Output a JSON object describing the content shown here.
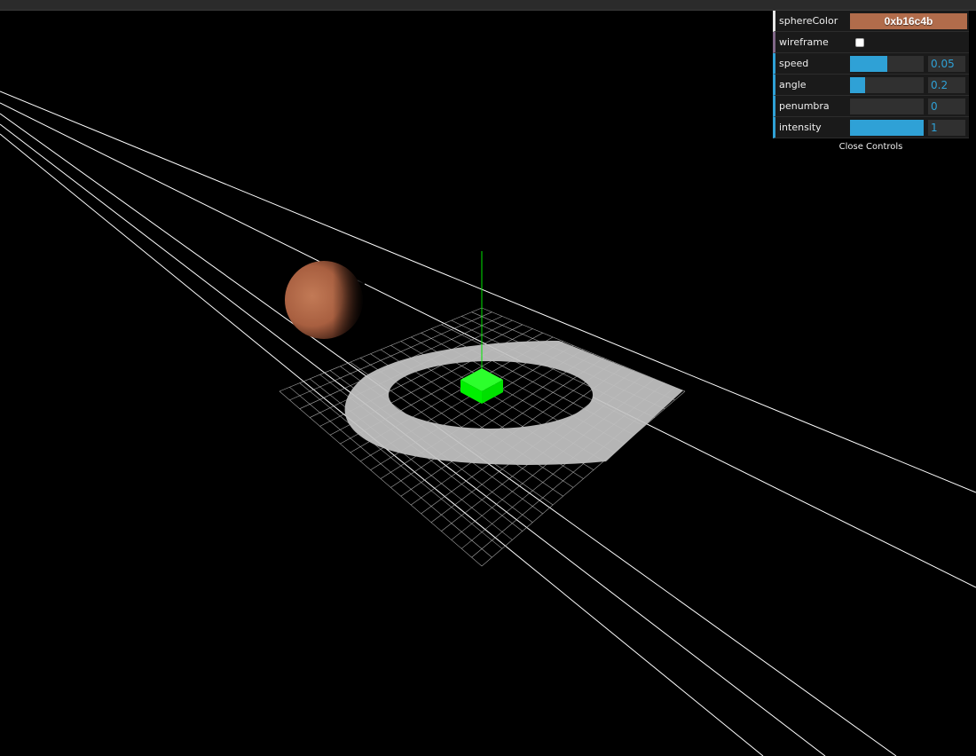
{
  "controls": {
    "sphereColor": {
      "label": "sphereColor",
      "value": "0xb16c4b",
      "swatch": "#b16c4b"
    },
    "wireframe": {
      "label": "wireframe",
      "checked": false
    },
    "speed": {
      "label": "speed",
      "value": "0.05",
      "fraction": 0.5
    },
    "angle": {
      "label": "angle",
      "value": "0.2",
      "fraction": 0.2
    },
    "penumbra": {
      "label": "penumbra",
      "value": "0",
      "fraction": 0.0
    },
    "intensity": {
      "label": "intensity",
      "value": "1",
      "fraction": 1.0
    },
    "close_label": "Close Controls"
  },
  "scene": {
    "sphere_color": "#b16c4b",
    "cube_color": "#00ff00",
    "light_line_color": "#ffffff",
    "grid_color": "#bfbfbf",
    "lit_floor_color": "#bdbdbd"
  }
}
